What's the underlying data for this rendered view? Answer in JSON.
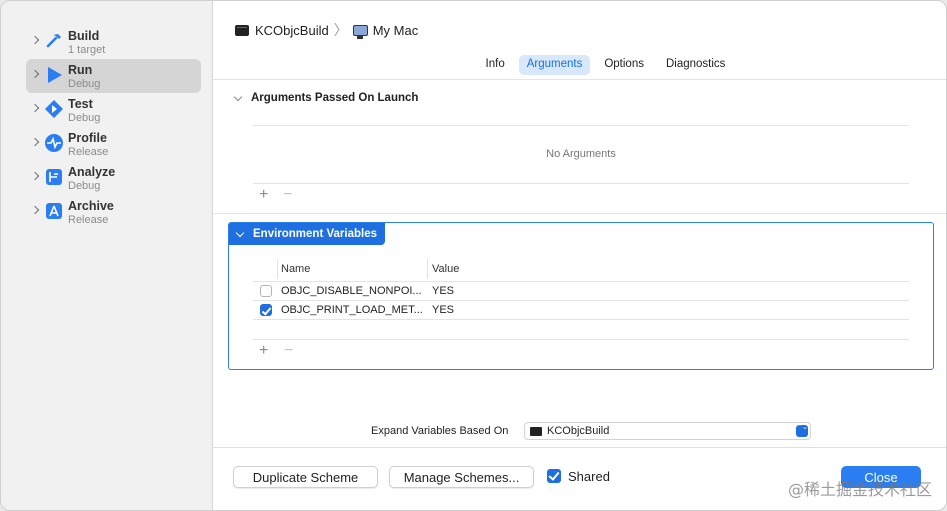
{
  "sidebar": {
    "items": [
      {
        "title": "Build",
        "subtitle": "1 target",
        "icon": "hammer-icon",
        "selected": false
      },
      {
        "title": "Run",
        "subtitle": "Debug",
        "icon": "play-icon",
        "selected": true
      },
      {
        "title": "Test",
        "subtitle": "Debug",
        "icon": "test-diamond-icon",
        "selected": false
      },
      {
        "title": "Profile",
        "subtitle": "Release",
        "icon": "instruments-icon",
        "selected": false
      },
      {
        "title": "Analyze",
        "subtitle": "Debug",
        "icon": "analyze-icon",
        "selected": false
      },
      {
        "title": "Archive",
        "subtitle": "Release",
        "icon": "archive-app-icon",
        "selected": false
      }
    ]
  },
  "breadcrumb": {
    "scheme": "KCObjcBuild",
    "separator": "〉",
    "destination": "My Mac"
  },
  "tabs": [
    {
      "label": "Info",
      "active": false
    },
    {
      "label": "Arguments",
      "active": true
    },
    {
      "label": "Options",
      "active": false
    },
    {
      "label": "Diagnostics",
      "active": false
    }
  ],
  "arguments": {
    "title": "Arguments Passed On Launch",
    "empty_text": "No Arguments",
    "add_label": "+",
    "remove_label": "−"
  },
  "environment": {
    "title": "Environment Variables",
    "columns": {
      "name": "Name",
      "value": "Value"
    },
    "rows": [
      {
        "checked": false,
        "name": "OBJC_DISABLE_NONPOI...",
        "value": "YES"
      },
      {
        "checked": true,
        "name": "OBJC_PRINT_LOAD_MET...",
        "value": "YES"
      }
    ],
    "add_label": "+",
    "remove_label": "−"
  },
  "expand_variables": {
    "label": "Expand Variables Based On",
    "selected": "KCObjcBuild",
    "arrow": "⌃⌄"
  },
  "footer": {
    "duplicate_label": "Duplicate Scheme",
    "manage_label": "Manage Schemes...",
    "shared_label": "Shared",
    "shared_checked": true,
    "close_label": "Close"
  },
  "watermark": "@稀土掘金技术社区",
  "colors": {
    "accent": "#1f6fe0",
    "selection": "#d5d5d5",
    "sidebar_bg": "#f1f1f1"
  }
}
